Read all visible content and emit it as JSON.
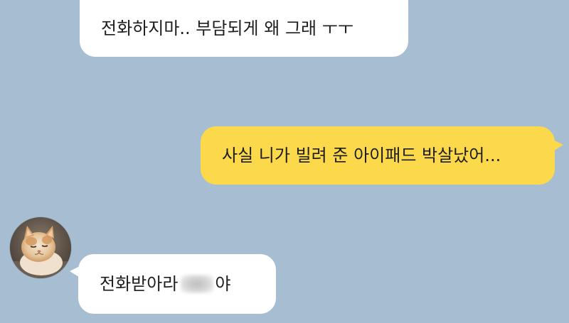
{
  "app": {
    "background_color": "#a7bed2",
    "incoming_bubble_color": "#ffffff",
    "outgoing_bubble_color": "#fcd94b"
  },
  "messages": [
    {
      "direction": "incoming",
      "text": "전화하지마.. 부담되게 왜 그래 ㅜㅜ"
    },
    {
      "direction": "outgoing",
      "text": "사실 니가 빌려 준 아이패드 박살났어..."
    },
    {
      "direction": "incoming",
      "text_before": "전화받아라",
      "text_after": "야",
      "has_blurred_name": true
    }
  ],
  "sender": {
    "avatar_icon": "cat-avatar-icon"
  }
}
